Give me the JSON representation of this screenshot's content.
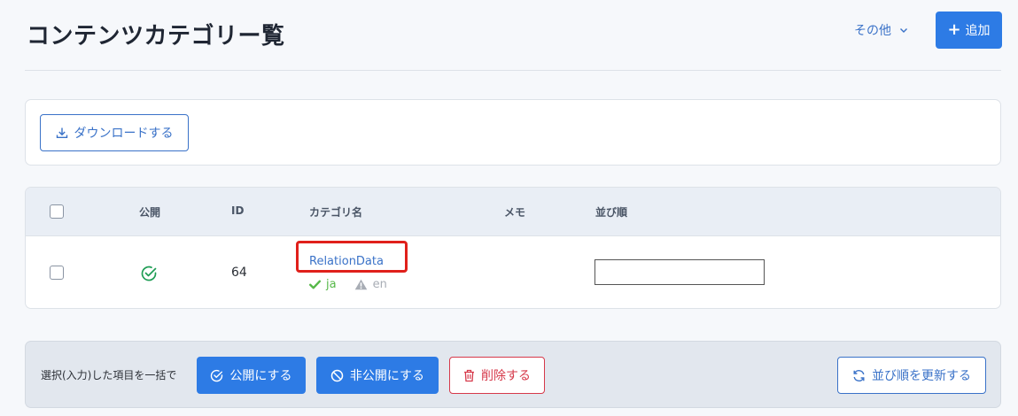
{
  "header": {
    "title": "コンテンツカテゴリー覧",
    "other_menu_label": "その他",
    "add_button_label": "追加"
  },
  "toolbar": {
    "download_label": "ダウンロードする"
  },
  "table": {
    "columns": {
      "published": "公開",
      "id": "ID",
      "category_name": "カテゴリ名",
      "memo": "メモ",
      "order": "並び順"
    },
    "rows": [
      {
        "published": true,
        "id": "64",
        "name": "RelationData",
        "languages": [
          {
            "code": "ja",
            "status": "ok"
          },
          {
            "code": "en",
            "status": "warning"
          }
        ],
        "memo": "",
        "order": ""
      }
    ]
  },
  "bulk": {
    "label": "選択(入力)した項目を一括で",
    "publish_label": "公開にする",
    "unpublish_label": "非公開にする",
    "delete_label": "削除する",
    "update_order_label": "並び順を更新する"
  },
  "colors": {
    "primary": "#2d7be5",
    "link": "#3a72c8",
    "danger": "#d6394a",
    "success": "#56b848",
    "highlight": "#e0201b"
  }
}
